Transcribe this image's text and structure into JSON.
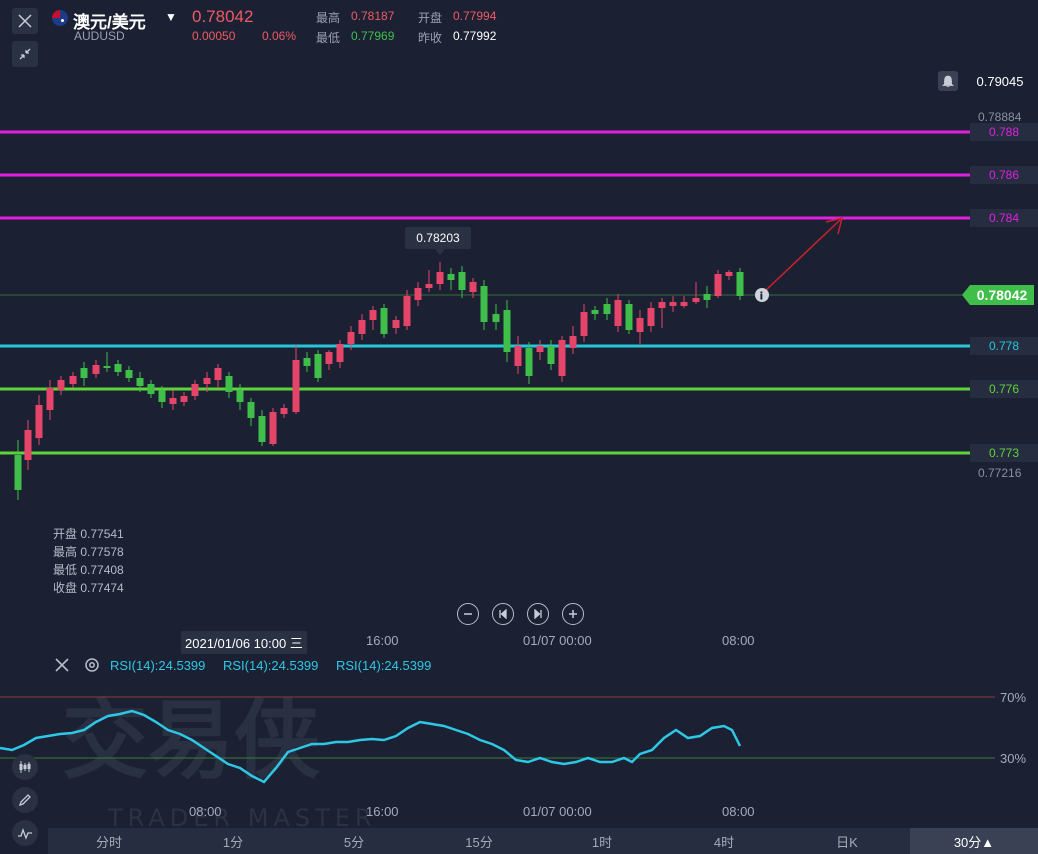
{
  "header": {
    "symbol": "澳元/美元",
    "code": "AUDUSD",
    "price": "0.78042",
    "change": "0.00050",
    "change_pct": "0.06%",
    "high_label": "最高",
    "high_value": "0.78187",
    "low_label": "最低",
    "low_value": "0.77969",
    "open_label": "开盘",
    "open_value": "0.77994",
    "prev_label": "昨收",
    "prev_value": "0.77992"
  },
  "price_axis": {
    "alert_price": "0.79045",
    "top_price": "0.78884",
    "bottom_price": "0.77216",
    "current_price": "0.78042",
    "levels": [
      {
        "label": "0.788",
        "color": "#e020e0"
      },
      {
        "label": "0.786",
        "color": "#e020e0"
      },
      {
        "label": "0.784",
        "color": "#e020e0"
      },
      {
        "label": "0.778",
        "color": "#26c6da"
      },
      {
        "label": "0.776",
        "color": "#5fd43a"
      },
      {
        "label": "0.773",
        "color": "#5fd43a"
      }
    ]
  },
  "peak_label": "0.78203",
  "ohlc": {
    "open": "开盘 0.77541",
    "high": "最高 0.77578",
    "low": "最低 0.77408",
    "close": "收盘 0.77474"
  },
  "time_axis": {
    "cursor": "2021/01/06 10:00 三",
    "t1": "16:00",
    "t2": "01/07 00:00",
    "t3": "08:00"
  },
  "indicator": {
    "rsi_1": "RSI(14):24.5399",
    "rsi_2": "RSI(14):24.5399",
    "rsi_3": "RSI(14):24.5399",
    "upper": "70%",
    "lower": "30%"
  },
  "lower_axis": {
    "t0": "08:00",
    "t1": "16:00",
    "t2": "01/07 00:00",
    "t3": "08:00"
  },
  "watermark": {
    "main": "交易侠",
    "sub": "TRADER MASTER"
  },
  "timeframes": [
    "分时",
    "1分",
    "5分",
    "15分",
    "1时",
    "4时",
    "日K",
    "30分▲"
  ],
  "colors": {
    "up": "#e6456a",
    "down": "#3fbf4a",
    "rsi": "#2ec8e6"
  }
}
